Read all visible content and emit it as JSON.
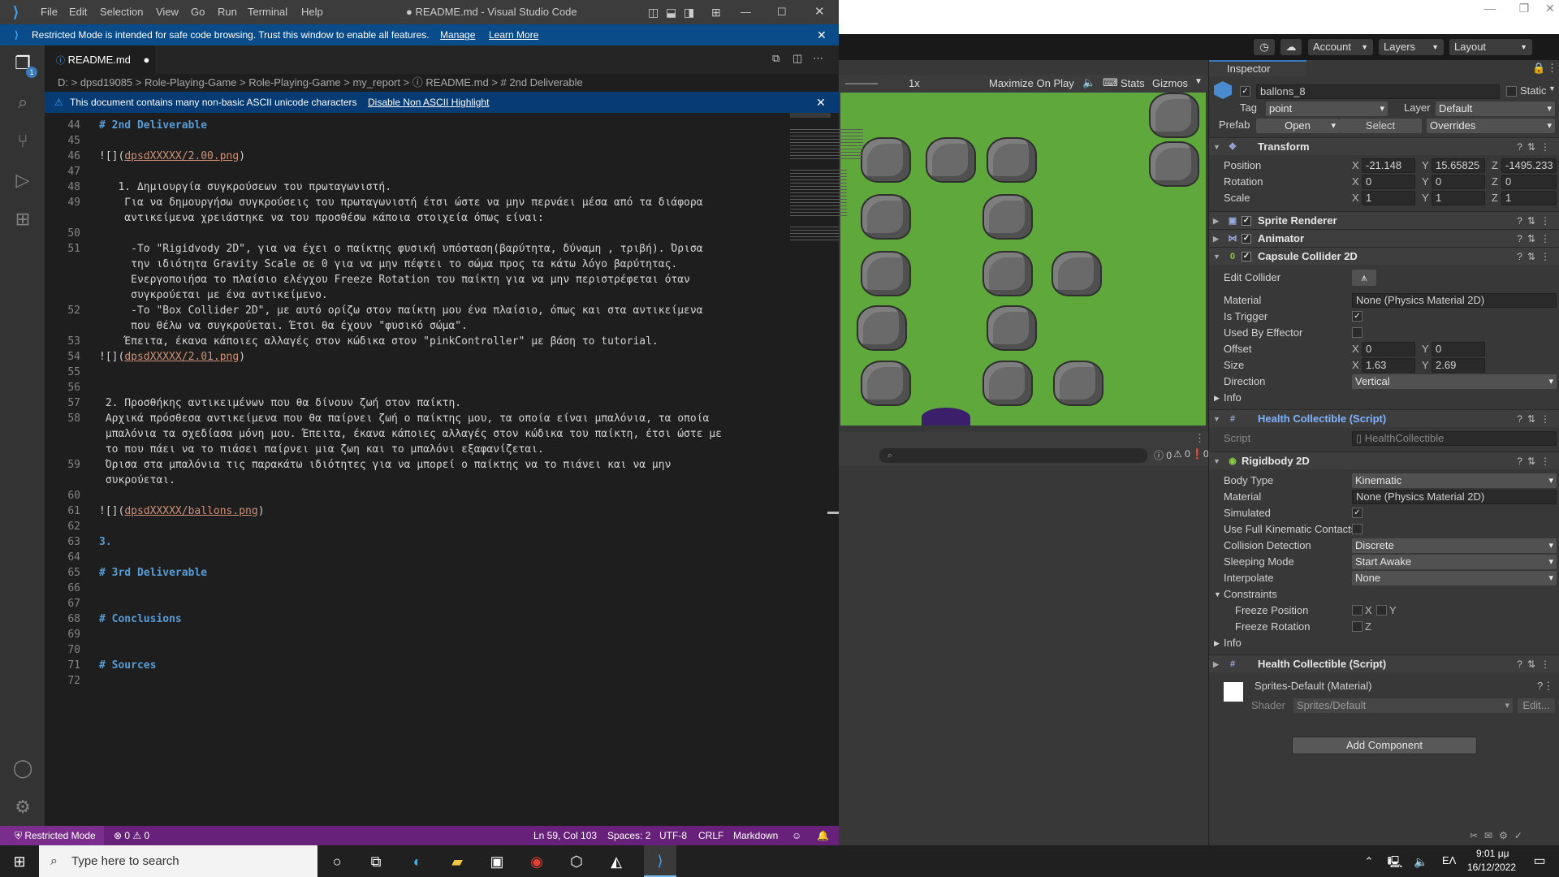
{
  "vscode": {
    "menu": [
      "File",
      "Edit",
      "Selection",
      "View",
      "Go",
      "Run",
      "Terminal",
      "Help"
    ],
    "window_title": "● README.md - Visual Studio Code",
    "restricted_banner": {
      "text": "Restricted Mode is intended for safe code browsing. Trust this window to enable all features.",
      "manage": "Manage",
      "learn_more": "Learn More"
    },
    "tab": {
      "label": "README.md"
    },
    "breadcrumb": "D: > dpsd19085 > Role-Playing-Game > Role-Playing-Game > my_report > ⓘ README.md > # 2nd Deliverable",
    "unicode_warning": {
      "text": "This document contains many non-basic ASCII unicode characters",
      "action": "Disable Non ASCII Highlight"
    },
    "lines": [
      {
        "n": "44",
        "segs": [
          {
            "t": "# 2nd Deliverable",
            "c": "hd"
          }
        ]
      },
      {
        "n": "45",
        "segs": []
      },
      {
        "n": "46",
        "segs": [
          {
            "t": "![](",
            "c": ""
          },
          {
            "t": "dpsdXXXXX/2.00.png",
            "c": "lnk"
          },
          {
            "t": ")",
            "c": ""
          }
        ]
      },
      {
        "n": "47",
        "segs": []
      },
      {
        "n": "48",
        "segs": [
          {
            "t": "   1. Δημιουργία συγκρούσεων του πρωταγωνιστή.",
            "c": ""
          }
        ]
      },
      {
        "n": "49",
        "segs": [
          {
            "t": "    Για να δημουργήσω συγκρούσεις του πρωταγωνιστή έτσι ώστε να μην περνάει μέσα από τα διάφορα",
            "c": ""
          }
        ]
      },
      {
        "n": "",
        "segs": [
          {
            "t": "    αντικείμενα χρειάστηκε να του προσθέσω κάποια στοιχεία όπως είναι:",
            "c": ""
          }
        ]
      },
      {
        "n": "50",
        "segs": []
      },
      {
        "n": "51",
        "segs": [
          {
            "t": "     -Το \"Rigidvody 2D\", για να έχει ο παίκτης φυσική υπόσταση(βαρύτητα, δύναμη , τριβή). Όρισα",
            "c": ""
          }
        ]
      },
      {
        "n": "",
        "segs": [
          {
            "t": "     την ιδιότητα Gravity Scale σε 0 για να μην πέφτει το σώμα προς τα κάτω λόγο βαρύτητας.",
            "c": ""
          }
        ]
      },
      {
        "n": "",
        "segs": [
          {
            "t": "     Ενεργοποιήσα το πλαίσιο ελέγχου Freeze Rotation του παίκτη για να μην περιστρέφεται όταν",
            "c": ""
          }
        ]
      },
      {
        "n": "",
        "segs": [
          {
            "t": "     συγκρούεται με ένα αντικείμενο.",
            "c": ""
          }
        ]
      },
      {
        "n": "52",
        "segs": [
          {
            "t": "     -Το \"Box Collider 2D\", με αυτό ορίζω στον παίκτη μου ένα πλαίσιο, όπως και στα αντικείμενα",
            "c": ""
          }
        ]
      },
      {
        "n": "",
        "segs": [
          {
            "t": "     που θέλω να συγκρούεται. Έτσι θα έχουν \"φυσικό σώμα\".",
            "c": ""
          }
        ]
      },
      {
        "n": "53",
        "segs": [
          {
            "t": "    Έπειτα, έκανα κάποιες αλλαγές στον κώδικα στον \"pinkController\" με βάση το tutorial.",
            "c": ""
          }
        ]
      },
      {
        "n": "54",
        "segs": [
          {
            "t": "![](",
            "c": ""
          },
          {
            "t": "dpsdXXXXX/2.01.png",
            "c": "lnk"
          },
          {
            "t": ")",
            "c": ""
          }
        ]
      },
      {
        "n": "55",
        "segs": []
      },
      {
        "n": "56",
        "segs": []
      },
      {
        "n": "57",
        "segs": [
          {
            "t": " 2. Προσθήκης αντικειμένων που θα δίνουν ζωή στον παίκτη.",
            "c": ""
          }
        ]
      },
      {
        "n": "58",
        "segs": [
          {
            "t": " Αρχικά πρόσθεσα αντικείμενα που θα παίρνει ζωή ο παίκτης μου, τα οποία είναι μπαλόνια, τα οποία",
            "c": ""
          }
        ]
      },
      {
        "n": "",
        "segs": [
          {
            "t": " μπαλόνια τα σχεδίασα μόνη μου. Έπειτα, έκανα κάποιες αλλαγές στον κώδικα του παίκτη, έτσι ώστε με",
            "c": ""
          }
        ]
      },
      {
        "n": "",
        "segs": [
          {
            "t": " το που πάει να το πιάσει παίρνει μια ζωη και το μπαλόνι εξαφανίζεται.",
            "c": ""
          }
        ]
      },
      {
        "n": "59",
        "segs": [
          {
            "t": " Όρισα στα μπαλόνια τις παρακάτω ιδιότητες για να μπορεί ο παίκτης να το πιάνει και να μην",
            "c": ""
          }
        ]
      },
      {
        "n": "",
        "segs": [
          {
            "t": " συκρούεται.",
            "c": ""
          }
        ]
      },
      {
        "n": "60",
        "segs": []
      },
      {
        "n": "61",
        "segs": [
          {
            "t": "![](",
            "c": ""
          },
          {
            "t": "dpsdXXXXX/ballons.png",
            "c": "lnk"
          },
          {
            "t": ")",
            "c": ""
          }
        ]
      },
      {
        "n": "62",
        "segs": []
      },
      {
        "n": "63",
        "segs": [
          {
            "t": "3.",
            "c": "hd"
          }
        ]
      },
      {
        "n": "64",
        "segs": []
      },
      {
        "n": "65",
        "segs": [
          {
            "t": "# 3rd Deliverable",
            "c": "hd"
          }
        ]
      },
      {
        "n": "66",
        "segs": []
      },
      {
        "n": "67",
        "segs": []
      },
      {
        "n": "68",
        "segs": [
          {
            "t": "# Conclusions",
            "c": "hd"
          }
        ]
      },
      {
        "n": "69",
        "segs": []
      },
      {
        "n": "70",
        "segs": []
      },
      {
        "n": "71",
        "segs": [
          {
            "t": "# Sources",
            "c": "hd"
          }
        ]
      },
      {
        "n": "72",
        "segs": []
      }
    ],
    "status": {
      "restricted": "⛨ Restricted Mode",
      "problems": "⊗ 0 ⚠ 0",
      "position": "Ln 59, Col 103",
      "spaces": "Spaces: 2",
      "encoding": "UTF-8",
      "eol": "CRLF",
      "language": "Markdown"
    }
  },
  "unity": {
    "toolbar": {
      "account": "Account",
      "layers": "Layers",
      "layout": "Layout"
    },
    "game_bar": {
      "scale": "1x",
      "maximize": "Maximize On Play",
      "stats": "Stats",
      "gizmos": "Gizmos"
    },
    "console_counts": [
      "0",
      "0",
      "0"
    ],
    "inspector": {
      "tab": "Inspector",
      "object_name": "ballons_8",
      "static": "Static",
      "tag_label": "Tag",
      "tag": "point",
      "layer_label": "Layer",
      "layer": "Default",
      "prefab_label": "Prefab",
      "open": "Open",
      "select": "Select",
      "overrides": "Overrides",
      "transform": {
        "title": "Transform",
        "position_label": "Position",
        "pos": [
          "-21.148",
          "15.65825",
          "-1495.233"
        ],
        "rotation_label": "Rotation",
        "rot": [
          "0",
          "0",
          "0"
        ],
        "scale_label": "Scale",
        "scale": [
          "1",
          "1",
          "1"
        ]
      },
      "sprite_renderer": "Sprite Renderer",
      "animator": "Animator",
      "capsule": {
        "title": "Capsule Collider 2D",
        "edit_collider": "Edit Collider",
        "material_label": "Material",
        "material": "None (Physics Material 2D)",
        "is_trigger": "Is Trigger",
        "used_by_effector": "Used By Effector",
        "offset_label": "Offset",
        "offset": [
          "0",
          "0"
        ],
        "size_label": "Size",
        "size": [
          "1.63",
          "2.69"
        ],
        "direction_label": "Direction",
        "direction": "Vertical",
        "info": "Info"
      },
      "health_script": {
        "title": "Health Collectible (Script)",
        "script_label": "Script",
        "script": "HealthCollectible"
      },
      "rigidbody": {
        "title": "Rigidbody 2D",
        "body_type_label": "Body Type",
        "body_type": "Kinematic",
        "material_label": "Material",
        "material": "None (Physics Material 2D)",
        "simulated": "Simulated",
        "full_kinematic": "Use Full Kinematic Contacts",
        "collision_label": "Collision Detection",
        "collision": "Discrete",
        "sleeping_label": "Sleeping Mode",
        "sleeping": "Start Awake",
        "interpolate_label": "Interpolate",
        "interpolate": "None",
        "constraints": "Constraints",
        "freeze_position": "Freeze Position",
        "freeze_rotation": "Freeze Rotation",
        "x": "X",
        "y": "Y",
        "z": "Z",
        "info": "Info"
      },
      "health_script2": "Health Collectible (Script)",
      "material_asset": "Sprites-Default (Material)",
      "shader_label": "Shader",
      "shader": "Sprites/Default",
      "edit": "Edit...",
      "add_component": "Add Component"
    }
  },
  "taskbar": {
    "search_placeholder": "Type here to search",
    "lang": "ΕΛ",
    "time": "9:01 μμ",
    "date": "16/12/2022"
  }
}
